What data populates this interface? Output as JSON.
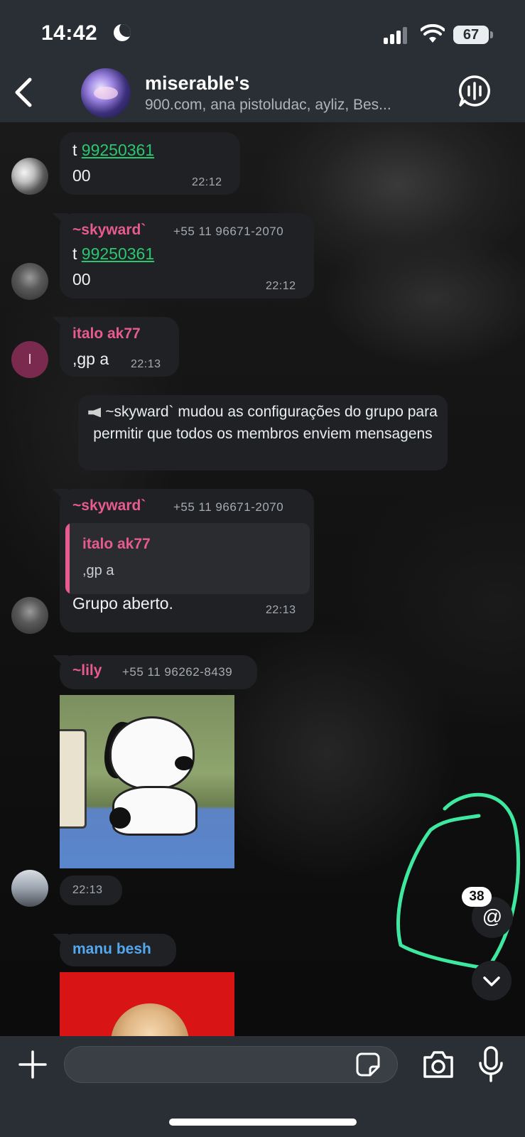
{
  "status_bar": {
    "time": "14:42",
    "battery": "67"
  },
  "header": {
    "group_name": "miserable's",
    "members": "900.com, ana pistoludac, ayliz, Bes..."
  },
  "messages": [
    {
      "type": "text",
      "text_prefix": "t ",
      "link": "99250361",
      "text_line2": "00",
      "time": "22:12"
    },
    {
      "type": "text",
      "sender": "~skyward`",
      "phone": "+55 11 96671-2070",
      "text_prefix": "t ",
      "link": "99250361",
      "text_line2": "00",
      "time": "22:12"
    },
    {
      "type": "text",
      "sender": "italo ak77",
      "avatar_initial": "I",
      "text": ",gp a",
      "time": "22:13"
    },
    {
      "type": "system",
      "text": "~skyward` mudou as configurações do grupo para permitir que todos os membros enviem mensagens"
    },
    {
      "type": "reply",
      "sender": "~skyward`",
      "phone": "+55 11 96671-2070",
      "quote_sender": "italo ak77",
      "quote_text": ",gp a",
      "text": "Grupo aberto.",
      "time": "22:13"
    },
    {
      "type": "image",
      "sender": "~lily",
      "phone": "+55 11 96262-8439",
      "time": "22:13"
    },
    {
      "type": "image",
      "sender": "manu besh"
    }
  ],
  "floating": {
    "mention_count": "38",
    "mention_symbol": "@"
  },
  "composer": {
    "placeholder": ""
  },
  "colors": {
    "header_bg": "#2a2f35",
    "bubble_bg": "#1f2124",
    "sender_pink": "#e75b8f",
    "sender_blue": "#53a8f0",
    "link_green": "#29c76f",
    "annotation_green": "#3ee8a0"
  }
}
